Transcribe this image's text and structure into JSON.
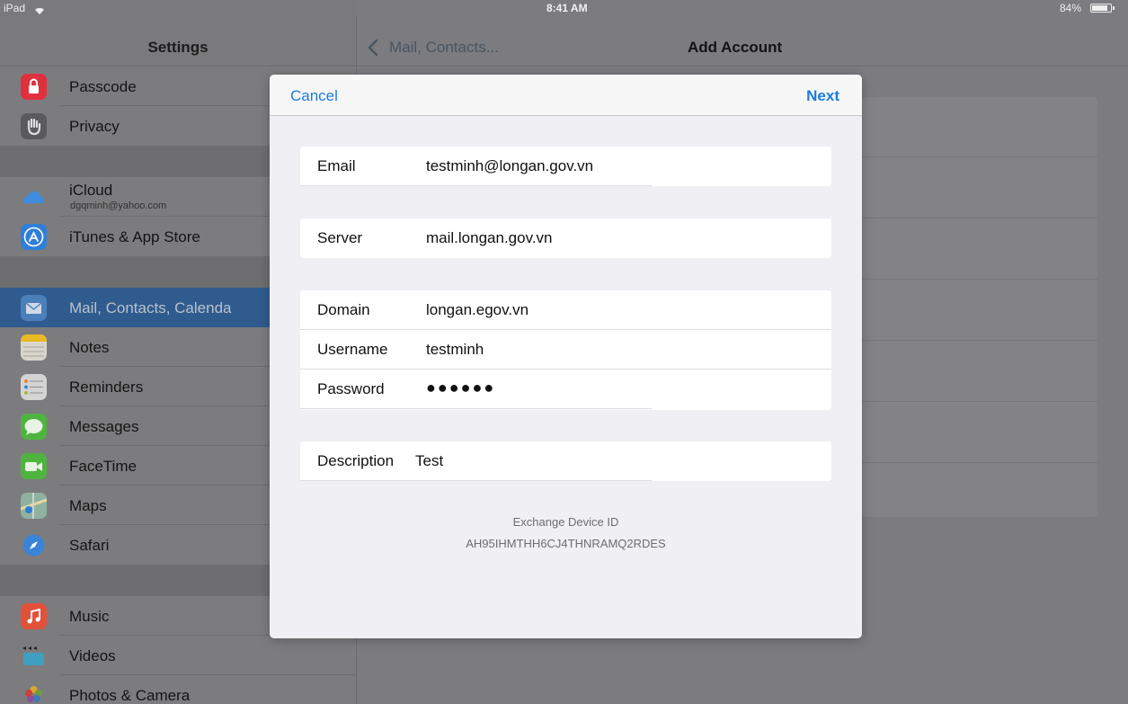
{
  "status_bar": {
    "device": "iPad",
    "time": "8:41 AM",
    "battery": "84%"
  },
  "sidebar": {
    "title": "Settings",
    "items": [
      {
        "label": "Passcode",
        "icon": "passcode-lock-icon"
      },
      {
        "label": "Privacy",
        "icon": "privacy-hand-icon"
      },
      {
        "label": "iCloud",
        "sublabel": "dgqminh@yahoo.com",
        "icon": "icloud-icon"
      },
      {
        "label": "iTunes & App Store",
        "icon": "app-store-icon"
      },
      {
        "label": "Mail, Contacts, Calenda",
        "icon": "mail-envelope-icon",
        "selected": true
      },
      {
        "label": "Notes",
        "icon": "notes-icon"
      },
      {
        "label": "Reminders",
        "icon": "reminders-icon"
      },
      {
        "label": "Messages",
        "icon": "messages-bubble-icon"
      },
      {
        "label": "FaceTime",
        "icon": "facetime-camera-icon"
      },
      {
        "label": "Maps",
        "icon": "maps-icon"
      },
      {
        "label": "Safari",
        "icon": "safari-compass-icon"
      },
      {
        "label": "Music",
        "icon": "music-note-icon"
      },
      {
        "label": "Videos",
        "icon": "videos-clapper-icon"
      },
      {
        "label": "Photos & Camera",
        "icon": "photos-flower-icon"
      }
    ]
  },
  "detail": {
    "back_label": "Mail, Contacts...",
    "title": "Add Account"
  },
  "modal": {
    "cancel_label": "Cancel",
    "next_label": "Next",
    "email": {
      "label": "Email",
      "value": "testminh@longan.gov.vn"
    },
    "server": {
      "label": "Server",
      "value": "mail.longan.gov.vn"
    },
    "domain": {
      "label": "Domain",
      "value": "longan.egov.vn"
    },
    "username": {
      "label": "Username",
      "value": "testminh"
    },
    "password": {
      "label": "Password",
      "value": "●●●●●●"
    },
    "description": {
      "label": "Description",
      "value": "Test"
    },
    "device_id_caption": "Exchange Device ID",
    "device_id": "AH95IHMTHH6CJ4THNRAMQ2RDES"
  },
  "colors": {
    "accent": "#1b7ddc",
    "selected_row": "#2f5b8f",
    "dimmed_background": "#7b7b80"
  }
}
